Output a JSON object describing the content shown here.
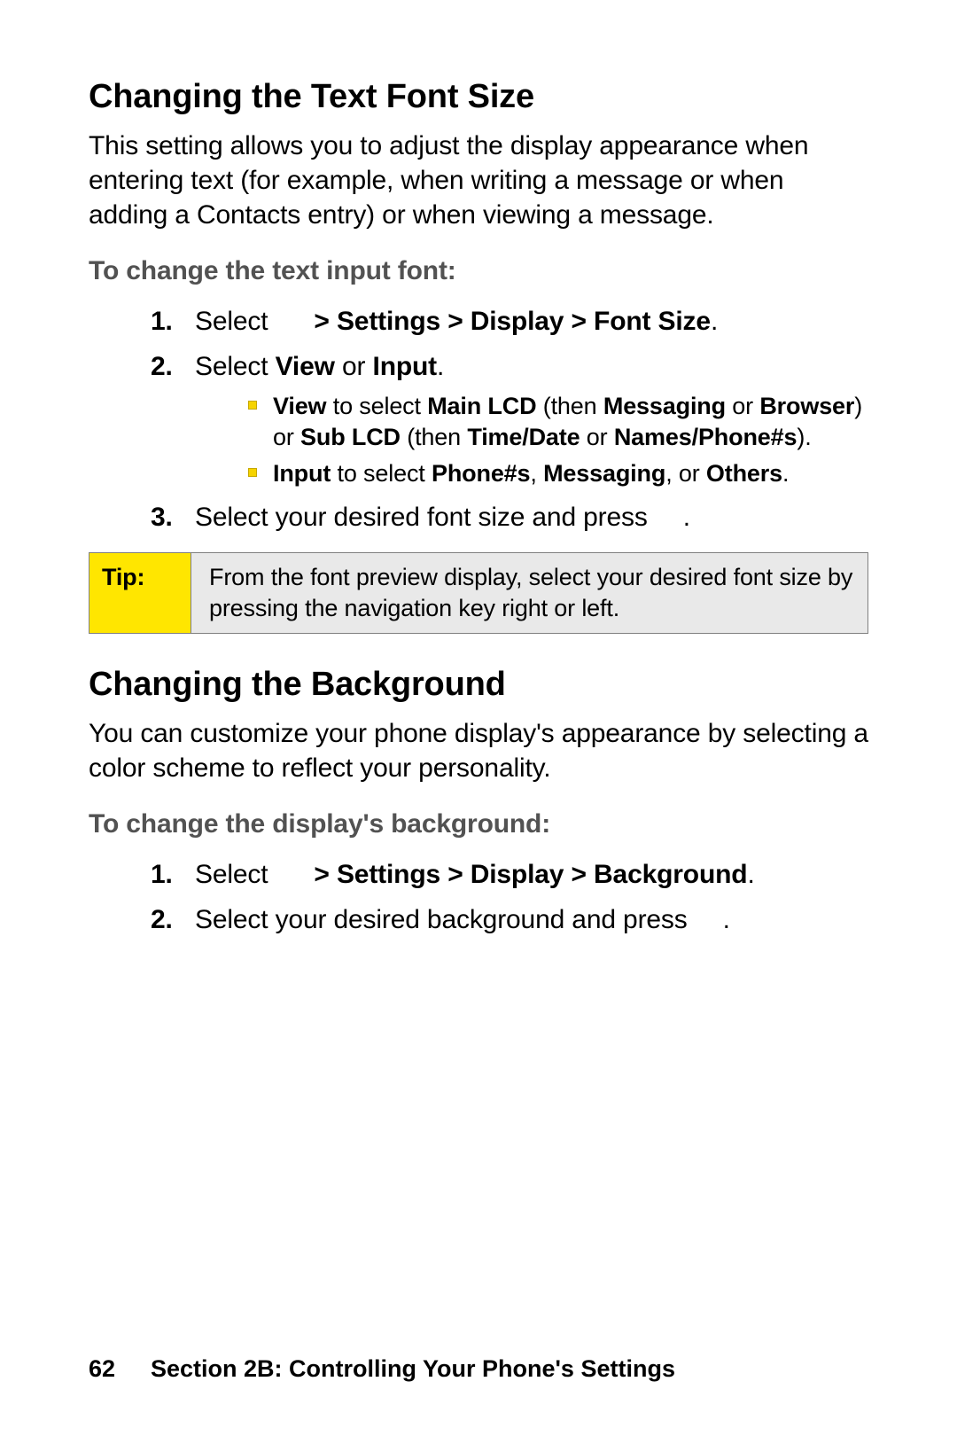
{
  "section1": {
    "heading": "Changing the Text Font Size",
    "intro": "This setting allows you to adjust the display appearance when entering text (for example, when writing a message or when adding a Contacts entry) or when viewing a message.",
    "subhead": "To change the text input font:",
    "step1_a": "Select",
    "step1_b": "> Settings > Display > Font Size",
    "step1_c": ".",
    "step2_a": "Select ",
    "step2_b": "View",
    "step2_c": " or ",
    "step2_d": "Input",
    "step2_e": ".",
    "bullet1_a": "View",
    "bullet1_b": " to select ",
    "bullet1_c": "Main LCD",
    "bullet1_d": " (then ",
    "bullet1_e": "Messaging",
    "bullet1_f": " or ",
    "bullet1_g": "Browser",
    "bullet1_h": ") or ",
    "bullet1_i": "Sub LCD",
    "bullet1_j": " (then ",
    "bullet1_k": "Time/Date",
    "bullet1_l": " or ",
    "bullet1_m": "Names/Phone#s",
    "bullet1_n": ").",
    "bullet2_a": "Input",
    "bullet2_b": " to select ",
    "bullet2_c": "Phone#s",
    "bullet2_d": ", ",
    "bullet2_e": "Messaging",
    "bullet2_f": ", or ",
    "bullet2_g": "Others",
    "bullet2_h": ".",
    "step3_a": "Select your desired font size and press",
    "step3_b": ".",
    "tip_label": "Tip:",
    "tip_text": "From the font preview display, select your desired font size by pressing the navigation key right or left."
  },
  "section2": {
    "heading": "Changing the Background",
    "intro": "You can customize your phone display's appearance by selecting a color scheme to reflect your personality.",
    "subhead": "To change the display's background:",
    "step1_a": "Select",
    "step1_b": "> Settings > Display > Background",
    "step1_c": ".",
    "step2_a": "Select your desired background and press",
    "step2_b": "."
  },
  "footer": {
    "page": "62",
    "text": "Section 2B: Controlling Your Phone's Settings"
  }
}
